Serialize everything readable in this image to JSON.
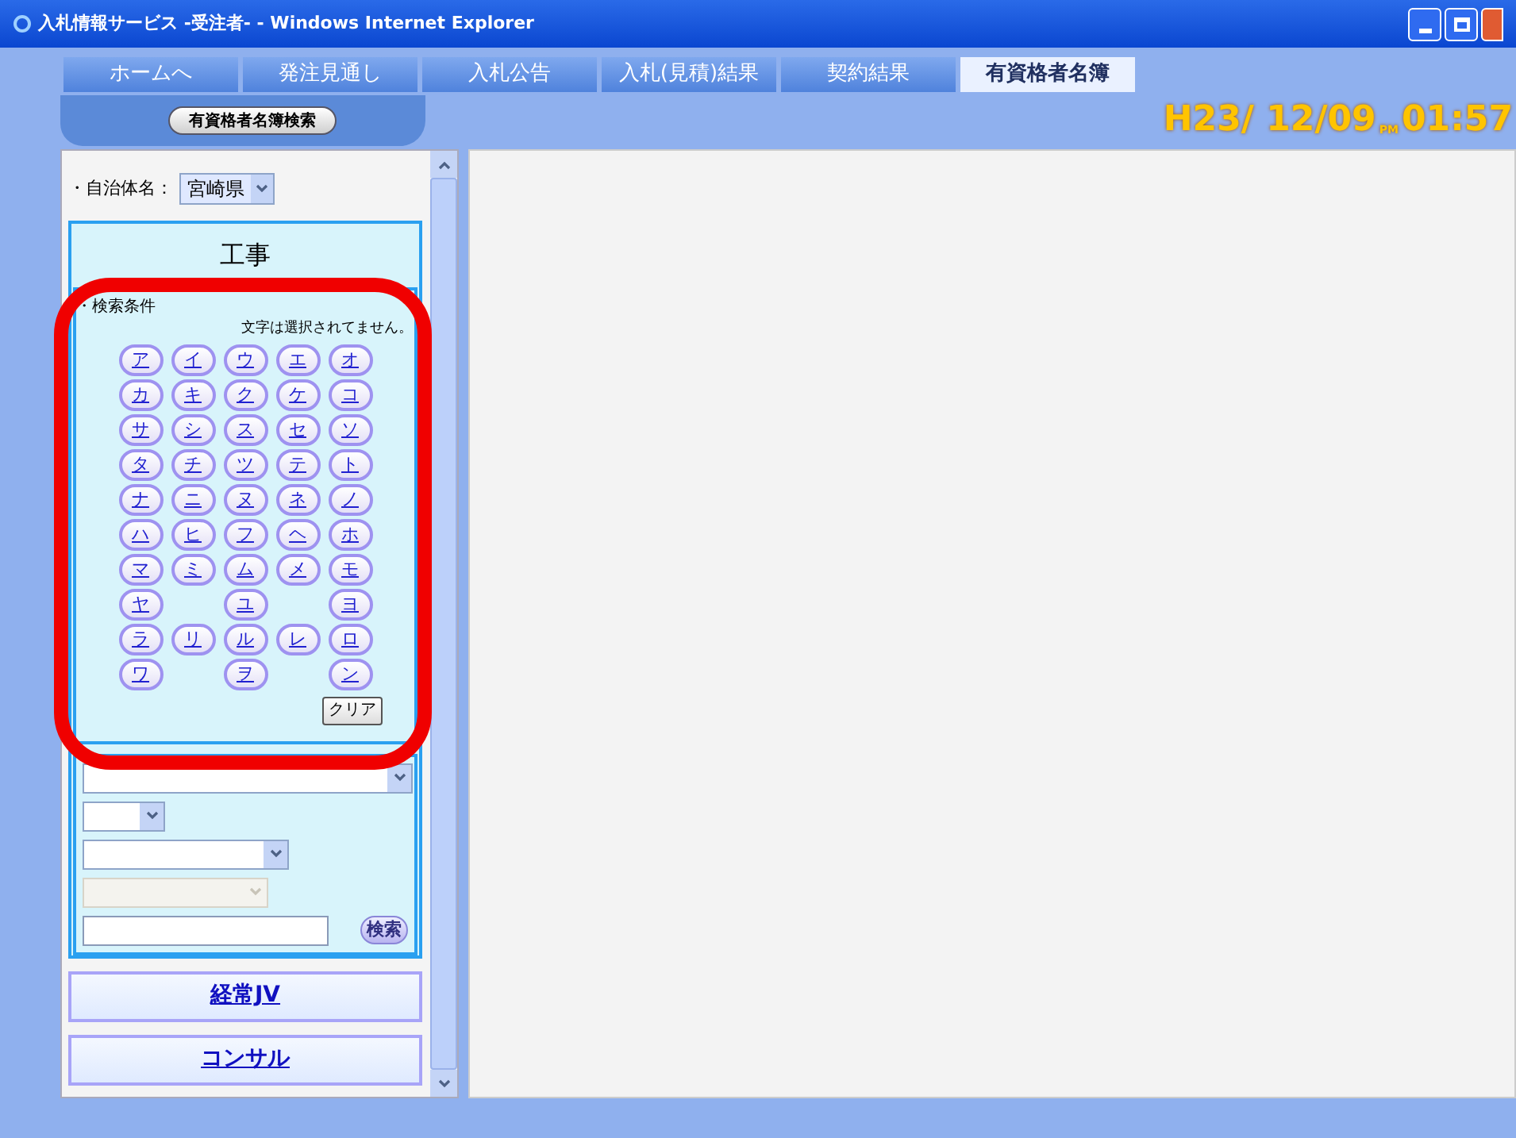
{
  "window": {
    "title": "入札情報サービス -受注者- - Windows Internet Explorer"
  },
  "tabs": [
    {
      "label": "ホームへ",
      "selected": false
    },
    {
      "label": "発注見通し",
      "selected": false
    },
    {
      "label": "入札公告",
      "selected": false
    },
    {
      "label": "入札(見積)結果",
      "selected": false
    },
    {
      "label": "契約結果",
      "selected": false
    },
    {
      "label": "有資格者名簿",
      "selected": true
    }
  ],
  "subtab": {
    "label": "有資格者名簿検索"
  },
  "clock": {
    "date": "H23/ 12/09",
    "ampm": "PM",
    "time": "01:57"
  },
  "municipality": {
    "label": "・自治体名：",
    "value": "宮崎県"
  },
  "section": {
    "title": "工事",
    "criteria_label": "・検索条件",
    "status": "文字は選択されてません。",
    "kana_rows": [
      [
        "ア",
        "イ",
        "ウ",
        "エ",
        "オ"
      ],
      [
        "カ",
        "キ",
        "ク",
        "ケ",
        "コ"
      ],
      [
        "サ",
        "シ",
        "ス",
        "セ",
        "ソ"
      ],
      [
        "タ",
        "チ",
        "ツ",
        "テ",
        "ト"
      ],
      [
        "ナ",
        "ニ",
        "ヌ",
        "ネ",
        "ノ"
      ],
      [
        "ハ",
        "ヒ",
        "フ",
        "ヘ",
        "ホ"
      ],
      [
        "マ",
        "ミ",
        "ム",
        "メ",
        "モ"
      ],
      [
        "ヤ",
        null,
        "ユ",
        null,
        "ヨ"
      ],
      [
        "ラ",
        "リ",
        "ル",
        "レ",
        "ロ"
      ],
      [
        "ワ",
        null,
        "ヲ",
        null,
        "ン"
      ]
    ],
    "clear_button": "クリア",
    "selects": [
      {
        "disabled": false
      },
      {
        "disabled": false
      },
      {
        "disabled": false
      },
      {
        "disabled": true
      }
    ],
    "search_button": "検索"
  },
  "other_sections": [
    "経常JV",
    "コンサル"
  ]
}
